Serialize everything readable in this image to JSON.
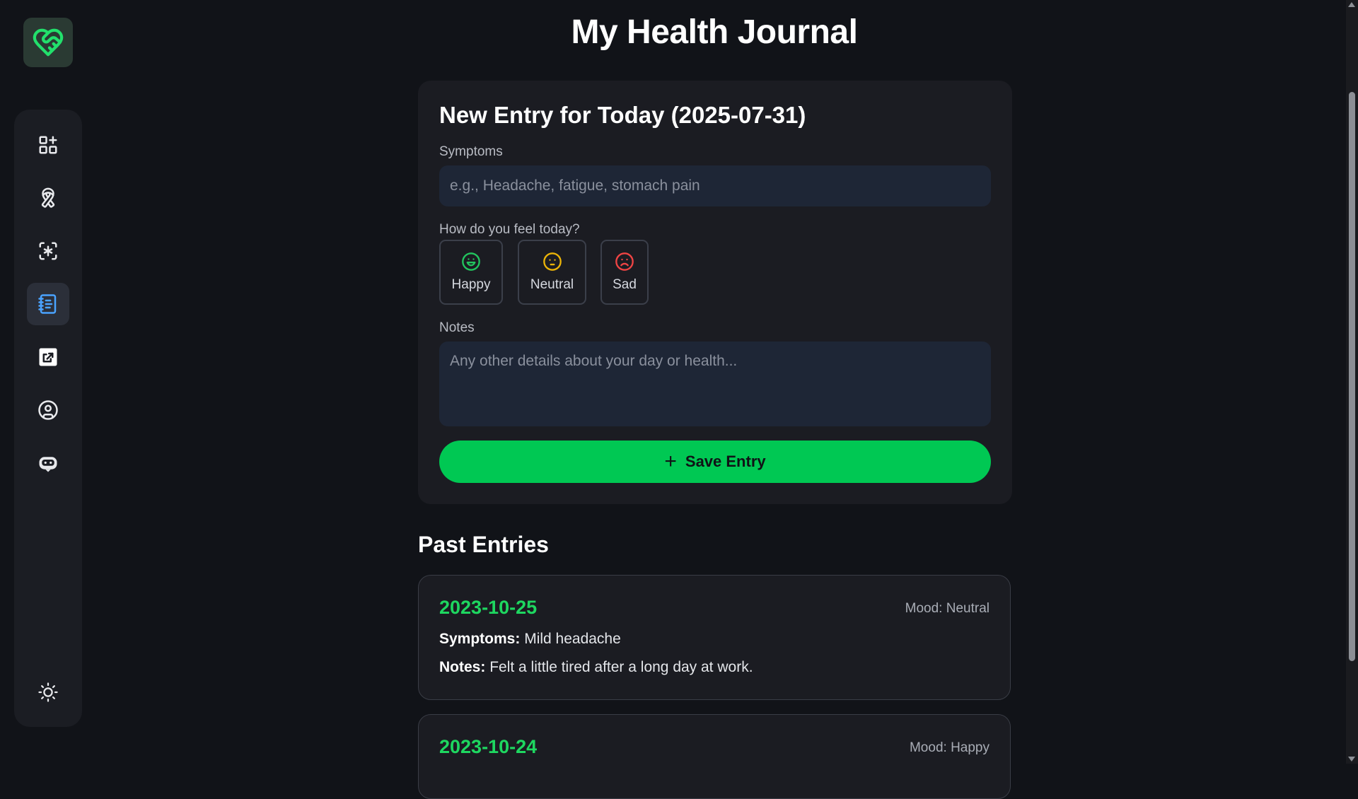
{
  "page": {
    "title": "My Health Journal"
  },
  "sidebar": {
    "logo_icon": "heart-handshake-icon",
    "items": [
      {
        "name": "dashboard",
        "icon": "dashboard-grid-icon",
        "active": false
      },
      {
        "name": "awareness",
        "icon": "ribbon-icon",
        "active": false
      },
      {
        "name": "scan",
        "icon": "scan-icon",
        "active": false
      },
      {
        "name": "journal",
        "icon": "notebook-icon",
        "active": true
      },
      {
        "name": "share",
        "icon": "share-icon",
        "active": false
      },
      {
        "name": "profile",
        "icon": "user-circle-icon",
        "active": false
      },
      {
        "name": "chatbot",
        "icon": "bot-icon",
        "active": false
      }
    ],
    "theme_toggle_icon": "sun-icon"
  },
  "new_entry": {
    "heading": "New Entry for Today (2025-07-31)",
    "symptoms_label": "Symptoms",
    "symptoms_placeholder": "e.g., Headache, fatigue, stomach pain",
    "mood_label": "How do you feel today?",
    "moods": [
      {
        "label": "Happy",
        "icon": "smile-icon",
        "color": "#22c55e"
      },
      {
        "label": "Neutral",
        "icon": "meh-icon",
        "color": "#eab308"
      },
      {
        "label": "Sad",
        "icon": "frown-icon",
        "color": "#ef4444"
      }
    ],
    "notes_label": "Notes",
    "notes_placeholder": "Any other details about your day or health...",
    "save_label": "Save Entry"
  },
  "past": {
    "title": "Past Entries",
    "entries": [
      {
        "date": "2023-10-25",
        "mood": "Mood: Neutral",
        "symptoms_label": "Symptoms:",
        "symptoms": "Mild headache",
        "notes_label": "Notes:",
        "notes": "Felt a little tired after a long day at work."
      },
      {
        "date": "2023-10-24",
        "mood": "Mood: Happy"
      }
    ]
  },
  "colors": {
    "accent": "#00c853",
    "date_green": "#1ed760",
    "background": "#111318",
    "card": "#1b1c22"
  }
}
